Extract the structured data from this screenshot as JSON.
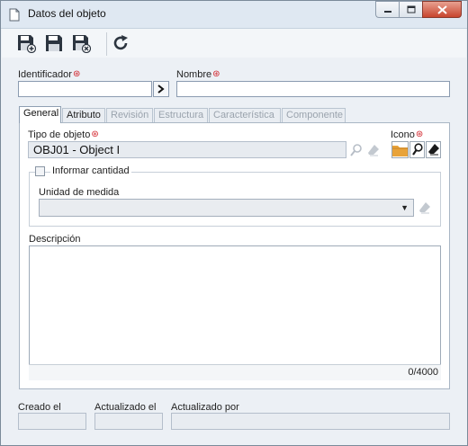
{
  "window": {
    "title": "Datos del objeto",
    "icon": "document-icon",
    "controls": [
      "minimize-icon",
      "maximize-icon",
      "close-icon"
    ]
  },
  "toolbar": {
    "buttons": [
      {
        "name": "save-new-button",
        "icon": "save-plus-icon"
      },
      {
        "name": "save-button",
        "icon": "save-icon"
      },
      {
        "name": "save-close-button",
        "icon": "save-close-icon"
      },
      {
        "name": "refresh-button",
        "icon": "refresh-icon"
      }
    ]
  },
  "header": {
    "identifier_label": "Identificador",
    "identifier_value": "",
    "name_label": "Nombre",
    "name_value": "",
    "required_mark": "⊛"
  },
  "tabs": [
    {
      "label": "General",
      "state": "active"
    },
    {
      "label": "Atributo",
      "state": "enabled"
    },
    {
      "label": "Revisión",
      "state": "disabled"
    },
    {
      "label": "Estructura",
      "state": "disabled"
    },
    {
      "label": "Característica",
      "state": "disabled"
    },
    {
      "label": "Componente",
      "state": "disabled"
    }
  ],
  "general": {
    "object_type_label": "Tipo de objeto",
    "object_type_value": "OBJ01 - Object I",
    "icon_label": "Icono",
    "inform_quantity_label": "Informar cantidad",
    "inform_quantity_checked": false,
    "unit_label": "Unidad de medida",
    "unit_value": "",
    "description_label": "Descripción",
    "description_value": "",
    "char_counter": "0/4000"
  },
  "footer": {
    "created_label": "Creado el",
    "created_value": "",
    "updated_label": "Actualizado el",
    "updated_value": "",
    "updated_by_label": "Actualizado por",
    "updated_by_value": ""
  },
  "colors": {
    "required": "#d2232a",
    "close_button": "#c8452e",
    "folder_icon": "#e8a33a"
  }
}
